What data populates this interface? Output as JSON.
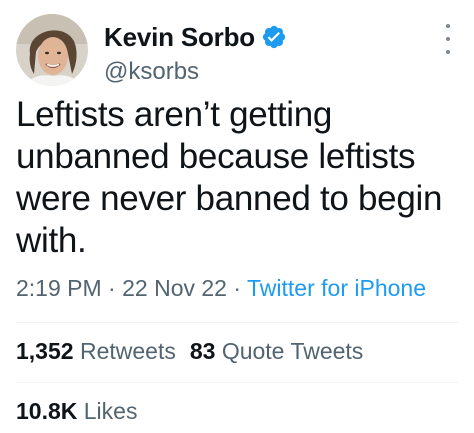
{
  "author": {
    "display_name": "Kevin Sorbo",
    "handle": "@ksorbs",
    "verified": true
  },
  "tweet": {
    "text_lines": [
      "Leftists aren’t getting",
      "unbanned because leftists",
      "were never banned to begin",
      "with."
    ],
    "time": "2:19 PM",
    "separator": "·",
    "date": "22 Nov 22",
    "source": "Twitter for iPhone"
  },
  "stats": {
    "retweets_count": "1,352",
    "retweets_label": "Retweets",
    "quotes_count": "83",
    "quotes_label": "Quote Tweets",
    "likes_count": "10.8K",
    "likes_label": "Likes"
  },
  "colors": {
    "accent": "#1d9bf0",
    "text_primary": "#0f1419",
    "text_secondary": "#536471"
  },
  "icons": {
    "verified": "verified-badge-icon",
    "more": "more-options-icon"
  }
}
